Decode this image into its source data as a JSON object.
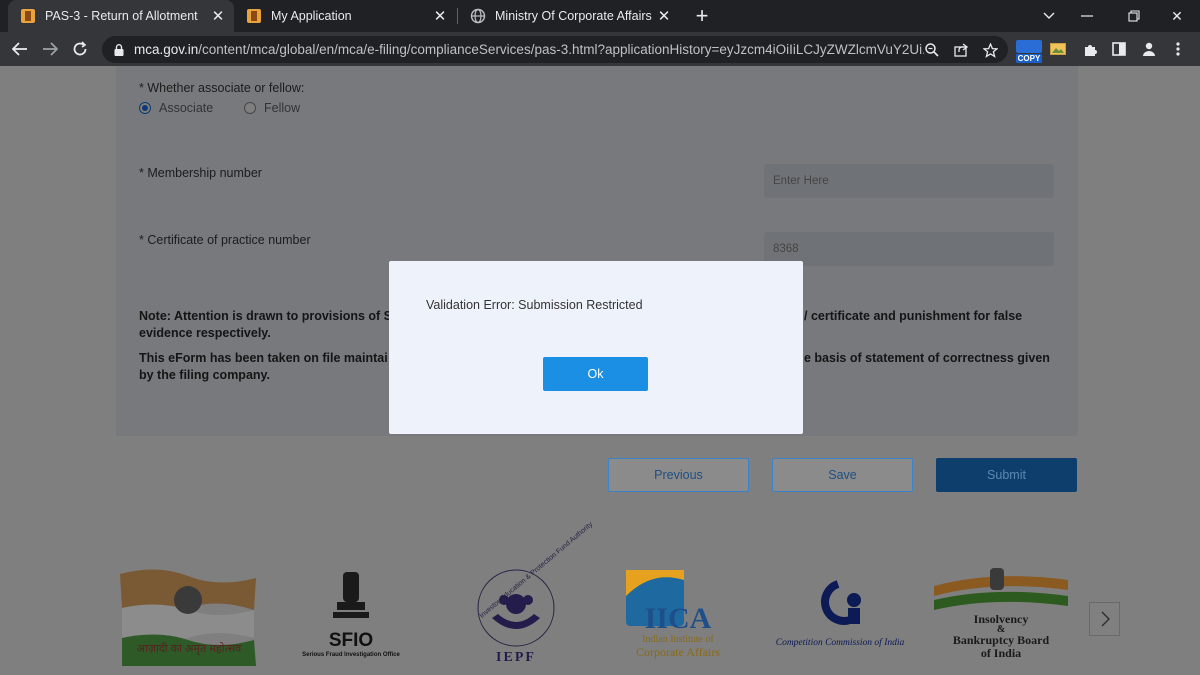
{
  "browser": {
    "tabs": [
      {
        "title": "PAS-3 - Return of Allotment",
        "active": true
      },
      {
        "title": "My Application",
        "active": false
      },
      {
        "title": "Ministry Of Corporate Affairs - M",
        "active": false
      }
    ],
    "url_host": "mca.gov.in",
    "url_path": "/content/mca/global/en/mca/e-filing/complianceServices/pas-3.html?applicationHistory=eyJzcm4iOiIiLCJyZWZlcmVuY2Ui...",
    "copy_extension_label": "COPY"
  },
  "form": {
    "associate_question": "* Whether associate or fellow:",
    "radio_associate": "Associate",
    "radio_fellow": "Fellow",
    "selected": "Associate",
    "membership_label": "* Membership number",
    "membership_placeholder": "Enter Here",
    "cop_label": "* Certificate of practice number",
    "cop_value": "8368",
    "note1_start": "Note: Attention is drawn to provisions of S",
    "note1_end_line1": "/ certificate and punishment for false",
    "note1_line2": "evidence respectively.",
    "note2_start": "This eForm has been taken on file maintai",
    "note2_end_line1": "e basis of statement of correctness given",
    "note2_line2": "by the filing company."
  },
  "buttons": {
    "previous": "Previous",
    "save": "Save",
    "submit": "Submit"
  },
  "dialog": {
    "message": "Validation Error: Submission Restricted",
    "ok_label": "Ok"
  },
  "footer_logos": {
    "azadi": "आज़ादी का अमृत महोत्सव",
    "sfio_title": "SFIO",
    "sfio_sub": "Serious Fraud Investigation Office",
    "iepf_title": "IEPF",
    "iepf_ring": "Investor Education & Protection Fund Authority",
    "iica_title": "IICA",
    "iica_sub1": "Indian Institute of",
    "iica_sub2": "Corporate Affairs",
    "cci": "Competition Commission of India",
    "ibbi1": "Insolvency",
    "ibbi2": "&",
    "ibbi3": "Bankruptcy Board",
    "ibbi4": "of India"
  },
  "colors": {
    "accent": "#1a8fe3",
    "submit": "#0d3e6c",
    "panel": "#eef3fb"
  }
}
